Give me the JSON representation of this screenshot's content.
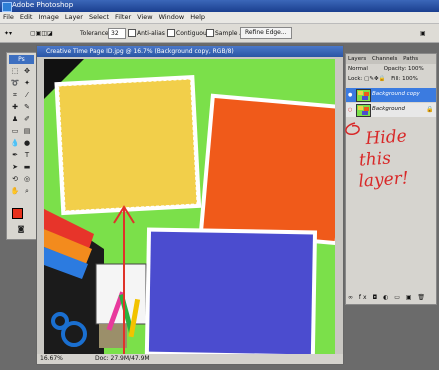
{
  "window": {
    "title": "Adobe Photoshop"
  },
  "menu": [
    "File",
    "Edit",
    "Image",
    "Layer",
    "Select",
    "Filter",
    "View",
    "Window",
    "Help"
  ],
  "options": {
    "tolerance_label": "Tolerance:",
    "tolerance_value": "32",
    "anti_alias": "Anti-alias",
    "contiguous": "Contiguous",
    "sample_all": "Sample All Layers",
    "refine_edge": "Refine Edge..."
  },
  "toolbox": {
    "badge": "Ps"
  },
  "document": {
    "title": "Creative Time Page ID.jpg @ 16.7% (Background copy, RGB/8)",
    "zoom": "16.67%",
    "doc_size": "Doc: 27.9M/47.9M"
  },
  "layers_panel": {
    "tabs": [
      "Layers",
      "Channels",
      "Paths"
    ],
    "blend_mode": "Normal",
    "opacity_label": "Opacity:",
    "opacity_value": "100%",
    "lock_label": "Lock:",
    "fill_label": "Fill:",
    "fill_value": "100%",
    "layers": [
      {
        "name": "Background copy",
        "selected": true
      },
      {
        "name": "Background",
        "selected": false
      }
    ]
  },
  "annotation": {
    "line1": "Hide",
    "line2": "this",
    "line3": "layer!"
  },
  "colors": {
    "accent": "#3b7be0",
    "annotation": "#d82828",
    "canvas_bg": "#7be04a"
  }
}
